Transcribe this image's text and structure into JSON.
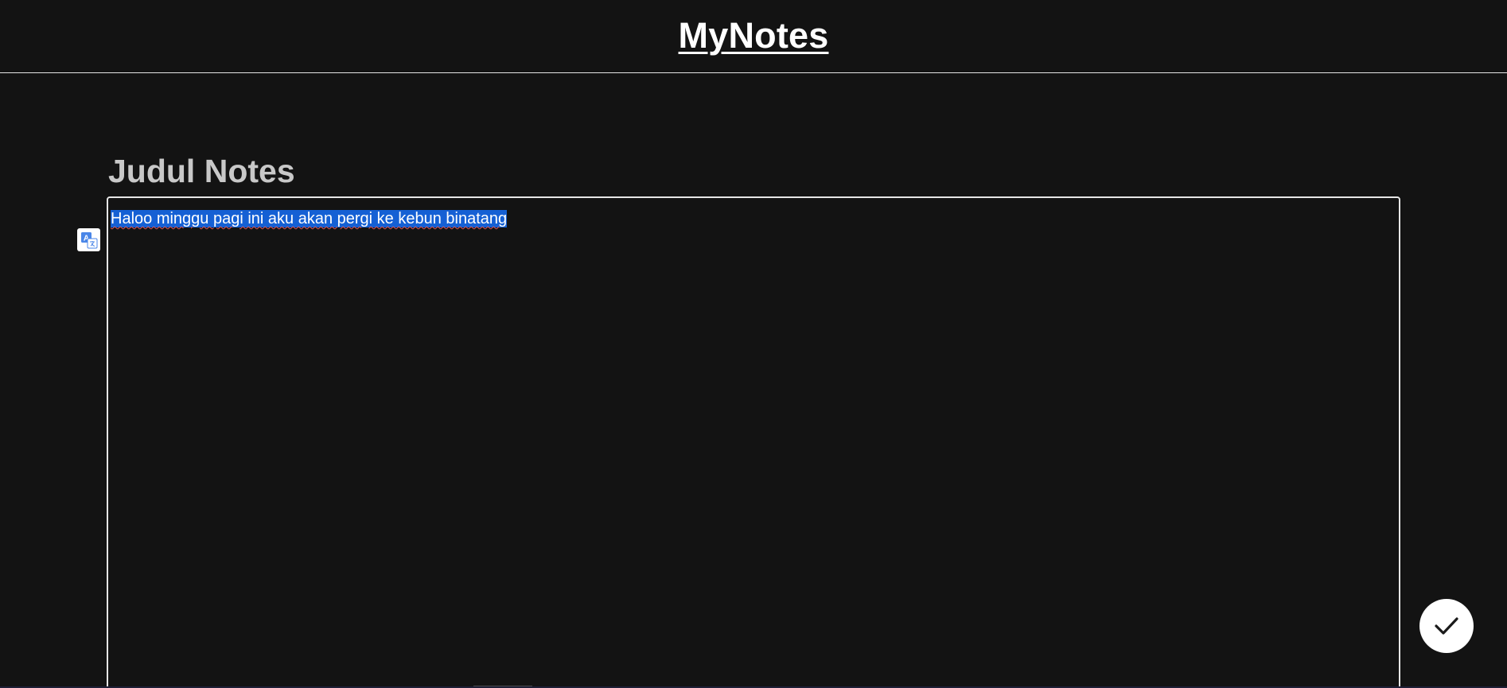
{
  "header": {
    "brand": "MyNotes"
  },
  "note": {
    "title_placeholder": "Judul Notes",
    "content": "Haloo minggu pagi ini aku akan pergi ke kebun binatang"
  },
  "icons": {
    "translate": "translate-icon",
    "save": "checkmark-icon"
  },
  "colors": {
    "background": "#131313",
    "border": "#e6e6e6",
    "title": "#c8c8c8",
    "selection": "#1560d4",
    "fab": "#ffffff"
  }
}
